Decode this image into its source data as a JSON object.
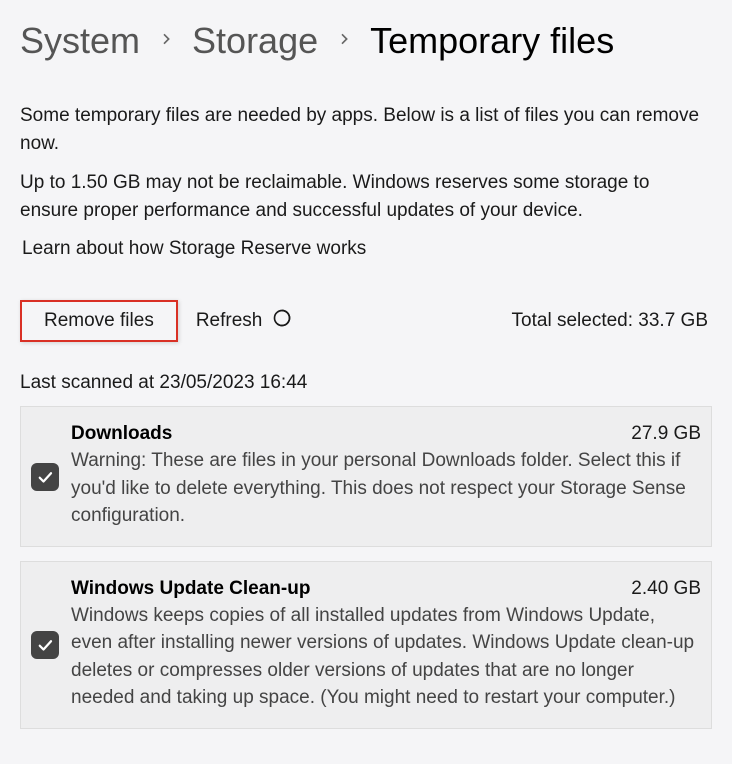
{
  "breadcrumb": {
    "items": [
      "System",
      "Storage",
      "Temporary files"
    ]
  },
  "description": {
    "line1": "Some temporary files are needed by apps. Below is a list of files you can remove now.",
    "line2": "Up to 1.50 GB may not be reclaimable. Windows reserves some storage to ensure proper performance and successful updates of your device."
  },
  "link": {
    "learn_more": "Learn about how Storage Reserve works"
  },
  "actions": {
    "remove_label": "Remove files",
    "refresh_label": "Refresh",
    "total_label": "Total selected: 33.7 GB"
  },
  "last_scanned": "Last scanned at 23/05/2023 16:44",
  "files": [
    {
      "title": "Downloads",
      "size": "27.9 GB",
      "description": "Warning: These are files in your personal Downloads folder. Select this if you'd like to delete everything. This does not respect your Storage Sense configuration."
    },
    {
      "title": "Windows Update Clean-up",
      "size": "2.40 GB",
      "description": "Windows keeps copies of all installed updates from Windows Update, even after installing newer versions of updates. Windows Update clean-up deletes or compresses older versions of updates that are no longer needed and taking up space. (You might need to restart your computer.)"
    }
  ]
}
